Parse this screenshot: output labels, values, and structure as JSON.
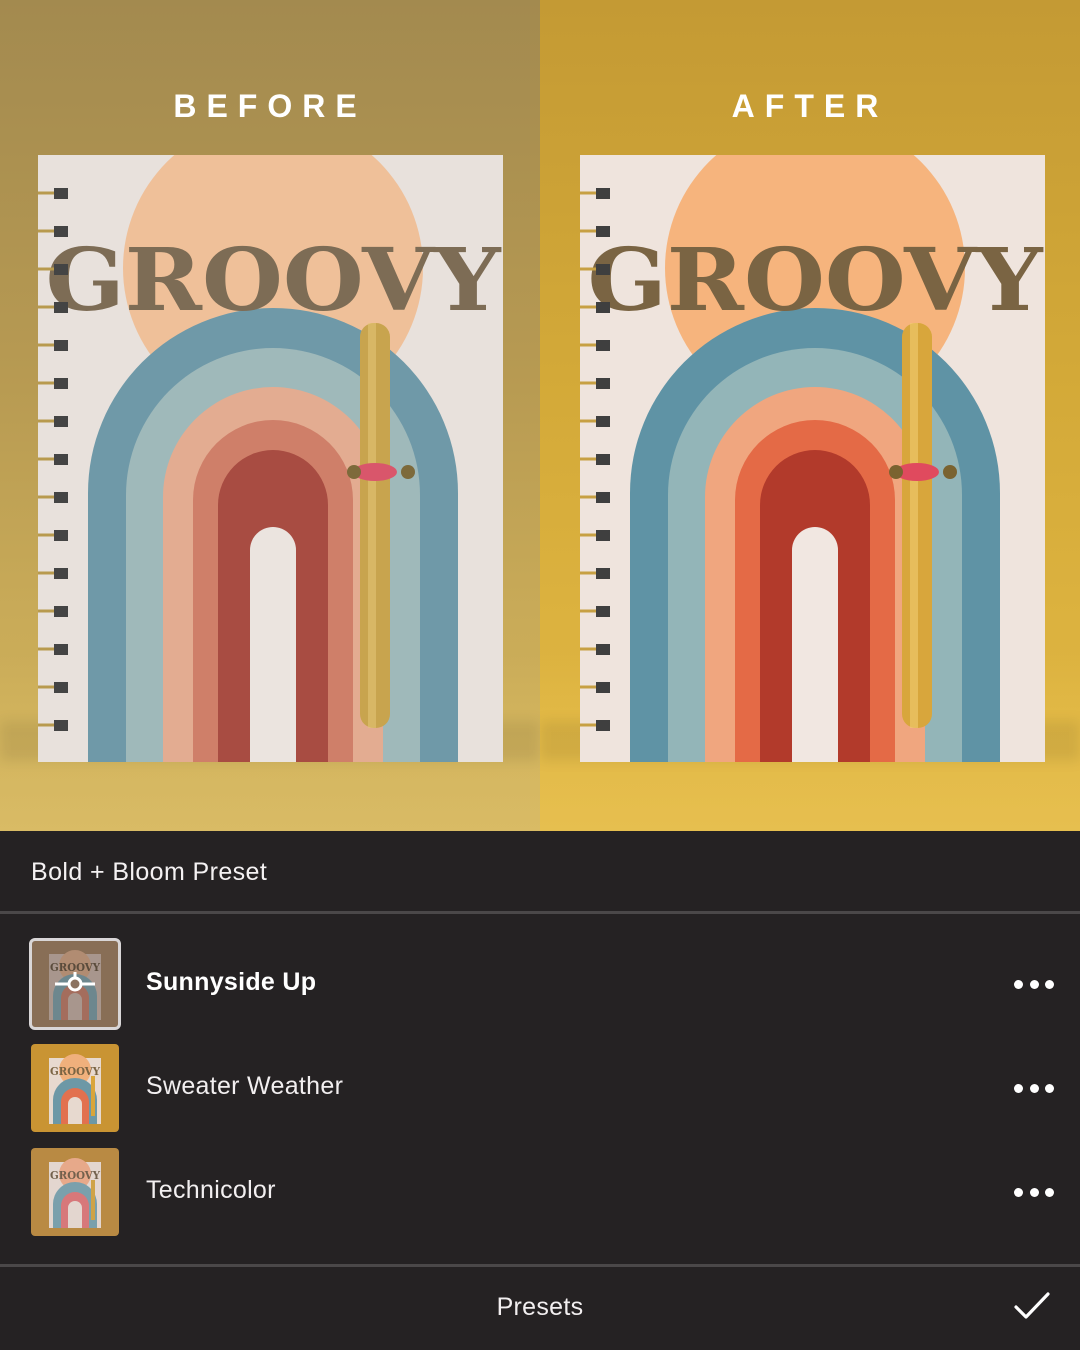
{
  "preview": {
    "before_label": "BEFORE",
    "after_label": "AFTER"
  },
  "sheet": {
    "group_title": "Bold + Bloom Preset",
    "presets": [
      {
        "name": "Sunnyside Up",
        "selected": true,
        "icon": "more-icon"
      },
      {
        "name": "Sweater Weather",
        "selected": false,
        "icon": "more-icon"
      },
      {
        "name": "Technicolor",
        "selected": false,
        "icon": "more-icon"
      }
    ],
    "footer_title": "Presets",
    "confirm_icon": "check-icon"
  },
  "colors": {
    "sheet_background": "#252223",
    "divider": "#4b4849",
    "text": "#ffffff"
  }
}
